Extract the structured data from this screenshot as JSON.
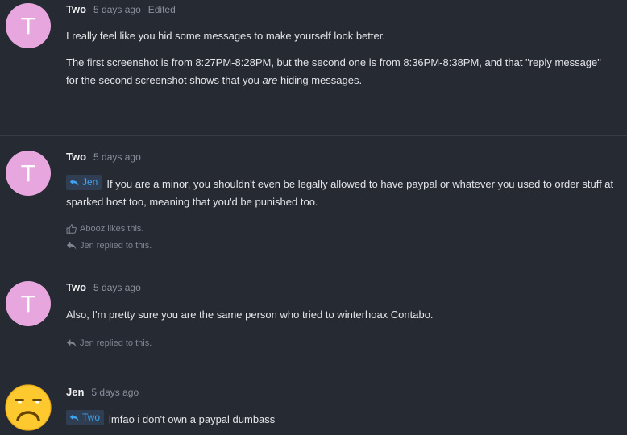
{
  "posts": [
    {
      "author": "Two",
      "avatar_letter": "T",
      "time": "5 days ago",
      "edited": "Edited",
      "paragraph1": "I really feel like you hid some messages to make yourself look better.",
      "paragraph2_part1": "The first screenshot is from 8:27PM-8:28PM, but the second one is from 8:36PM-8:38PM, and that \"reply message\" for the second screenshot shows that you ",
      "paragraph2_em": "are",
      "paragraph2_part2": " hiding messages."
    },
    {
      "author": "Two",
      "avatar_letter": "T",
      "time": "5 days ago",
      "quote_name": "Jen",
      "text": "If you are a minor, you shouldn't even be legally allowed to have paypal or whatever you used to order stuff at sparked host too, meaning that you'd be punished too.",
      "likes": "Abooz likes this.",
      "replied": "Jen replied to this."
    },
    {
      "author": "Two",
      "avatar_letter": "T",
      "time": "5 days ago",
      "text": "Also, I'm pretty sure you are the same person who tried to winterhoax Contabo.",
      "replied": "Jen replied to this."
    },
    {
      "author": "Jen",
      "time": "5 days ago",
      "avatar_icon": "unamused-face-icon",
      "quote_name": "Two",
      "text": "lmfao i don't own a paypal dumbass"
    }
  ],
  "colors": {
    "background": "#262a33",
    "avatar": "#e7a6de",
    "quote_bg": "#2f3e52",
    "quote_text": "#3da3f2",
    "muted": "#8b919c"
  }
}
